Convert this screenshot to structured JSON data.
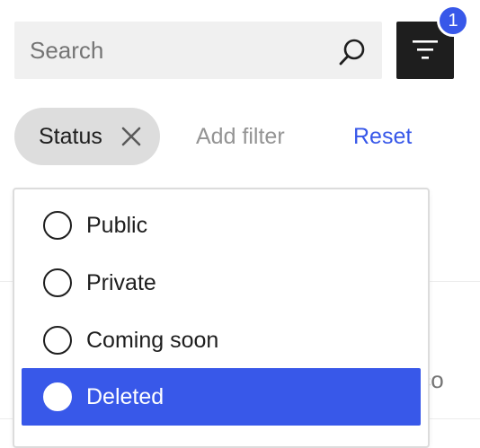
{
  "search": {
    "placeholder": "Search",
    "value": ""
  },
  "filter_button": {
    "badge": "1"
  },
  "filters": {
    "active_chip": "Status",
    "add_filter_label": "Add filter",
    "reset_label": "Reset"
  },
  "dropdown": {
    "options": [
      {
        "label": "Public",
        "selected": false
      },
      {
        "label": "Private",
        "selected": false
      },
      {
        "label": "Coming soon",
        "selected": false
      },
      {
        "label": "Deleted",
        "selected": true
      }
    ]
  },
  "background_table": {
    "visible_fragment": "ss.co"
  },
  "colors": {
    "accent": "#3858e9",
    "dark": "#1e1e1e",
    "input_bg": "#f0f0f0",
    "chip_bg": "#dddddd",
    "muted_text": "#949494"
  }
}
